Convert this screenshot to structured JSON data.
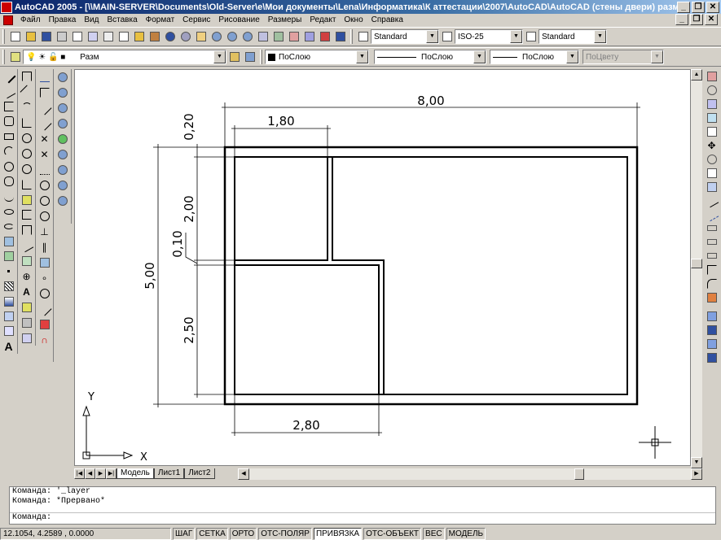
{
  "window": {
    "title": "AutoCAD 2005 - [\\\\MAIN-SERVER\\Documents\\Old-Server\\e\\Мои документы\\Lena\\Информатика\\К аттестации\\2007\\AutoCAD\\AutoCAD (стены двери) разм.dwg]",
    "minimize": "_",
    "restore": "❐",
    "close": "✕"
  },
  "menu": [
    "Файл",
    "Правка",
    "Вид",
    "Вставка",
    "Формат",
    "Сервис",
    "Рисование",
    "Размеры",
    "Редакт",
    "Окно",
    "Справка"
  ],
  "styles": {
    "text_style": "Standard",
    "dim_style": "ISO-25",
    "table_style": "Standard"
  },
  "layers": {
    "current_layer": "Разм",
    "color": "ПоСлою",
    "linetype": "ПоСлою",
    "lineweight": "ПоСлою",
    "plotstyle": "ПоЦвету"
  },
  "drawing": {
    "dims": {
      "overall_width": "8,00",
      "top_room_width": "1,80",
      "bottom_room_width": "2,80",
      "overall_height": "5,00",
      "top_gap": "0,20",
      "top_room_height": "2,00",
      "wall_gap": "0,10",
      "bottom_room_height": "2,50"
    },
    "ucs": {
      "x": "X",
      "y": "Y"
    }
  },
  "tabs": [
    "Модель",
    "Лист1",
    "Лист2"
  ],
  "command": {
    "line1": "Команда: '_layer",
    "line2": "Команда: *Прервано*",
    "prompt": "Команда:"
  },
  "status": {
    "coords": "12.1054, 4.2589 , 0.0000",
    "toggles": [
      "ШАГ",
      "СЕТКА",
      "ОРТО",
      "ОТС-ПОЛЯР",
      "ПРИВЯЗКА",
      "ОТС-ОБЪЕКТ",
      "ВЕС",
      "МОДЕЛЬ"
    ]
  }
}
